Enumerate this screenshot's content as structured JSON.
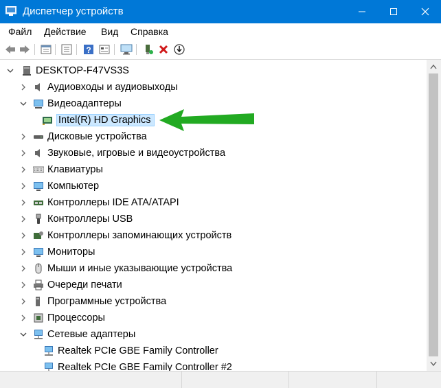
{
  "window": {
    "title": "Диспетчер устройств",
    "accent": "#0078d7"
  },
  "menu": [
    "Файл",
    "Действие",
    "Вид",
    "Справка"
  ],
  "toolbar": {
    "icons": [
      "back-arrow-icon",
      "forward-arrow-icon",
      "properties-icon",
      "list-icon",
      "help-icon",
      "view-icon",
      "monitor-icon",
      "add-driver-icon",
      "uninstall-icon",
      "update-driver-icon"
    ]
  },
  "tree": {
    "root": "DESKTOP-F47VS3S",
    "items": [
      {
        "label": "Аудиовходы и аудиовыходы",
        "icon": "speaker-icon",
        "expanded": false
      },
      {
        "label": "Видеоадаптеры",
        "icon": "display-adapter-icon",
        "expanded": true
      },
      {
        "label": "Intel(R) HD Graphics",
        "icon": "display-adapter-icon",
        "child": true,
        "selected": true
      },
      {
        "label": "Дисковые устройства",
        "icon": "disk-icon",
        "expanded": false
      },
      {
        "label": "Звуковые, игровые и видеоустройства",
        "icon": "speaker-icon",
        "expanded": false
      },
      {
        "label": "Клавиатуры",
        "icon": "keyboard-icon",
        "expanded": false
      },
      {
        "label": "Компьютер",
        "icon": "computer-icon",
        "expanded": false
      },
      {
        "label": "Контроллеры IDE ATA/ATAPI",
        "icon": "ide-controller-icon",
        "expanded": false
      },
      {
        "label": "Контроллеры USB",
        "icon": "usb-icon",
        "expanded": false
      },
      {
        "label": "Контроллеры запоминающих устройств",
        "icon": "storage-controller-icon",
        "expanded": false
      },
      {
        "label": "Мониторы",
        "icon": "monitor-icon",
        "expanded": false
      },
      {
        "label": "Мыши и иные указывающие устройства",
        "icon": "mouse-icon",
        "expanded": false
      },
      {
        "label": "Очереди печати",
        "icon": "printer-icon",
        "expanded": false
      },
      {
        "label": "Программные устройства",
        "icon": "software-device-icon",
        "expanded": false
      },
      {
        "label": "Процессоры",
        "icon": "processor-icon",
        "expanded": false
      },
      {
        "label": "Сетевые адаптеры",
        "icon": "network-icon",
        "expanded": true
      },
      {
        "label": "Realtek PCIe GBE Family Controller",
        "icon": "network-icon",
        "child": true
      },
      {
        "label": "Realtek PCIe GBE Family Controller #2",
        "icon": "network-icon",
        "child": true
      }
    ]
  },
  "annotation": {
    "color": "#22aa22"
  }
}
